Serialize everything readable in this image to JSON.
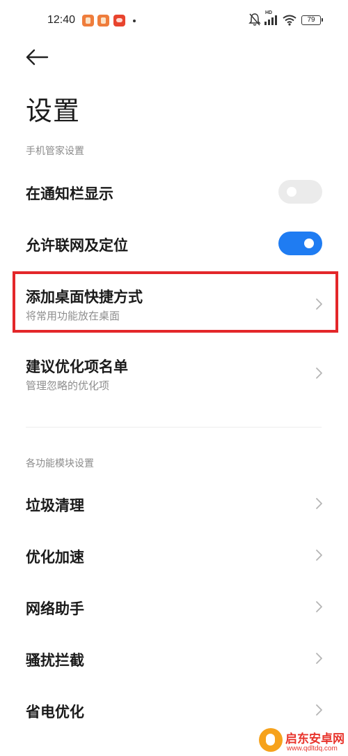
{
  "status_bar": {
    "time": "12:40",
    "battery": "79",
    "network_label": "HD",
    "icons": [
      "app-notification-icon",
      "app-notification-icon",
      "app-notification-icon",
      "mute-icon",
      "signal-icon",
      "wifi-icon",
      "battery-icon"
    ]
  },
  "header": {
    "back_icon": "back-arrow-icon",
    "title": "设置"
  },
  "sections": {
    "phone_manager": {
      "header": "手机管家设置",
      "items": [
        {
          "title": "在通知栏显示",
          "control": "toggle",
          "enabled": false
        },
        {
          "title": "允许联网及定位",
          "control": "toggle",
          "enabled": true
        },
        {
          "title": "添加桌面快捷方式",
          "subtitle": "将常用功能放在桌面",
          "control": "chevron"
        },
        {
          "title": "建议优化项名单",
          "subtitle": "管理忽略的优化项",
          "control": "chevron"
        }
      ]
    },
    "modules": {
      "header": "各功能模块设置",
      "items": [
        {
          "title": "垃圾清理",
          "control": "chevron"
        },
        {
          "title": "优化加速",
          "control": "chevron"
        },
        {
          "title": "网络助手",
          "control": "chevron"
        },
        {
          "title": "骚扰拦截",
          "control": "chevron"
        },
        {
          "title": "省电优化",
          "control": "chevron"
        }
      ]
    }
  },
  "watermark": {
    "title": "启东安卓网",
    "url": "www.qdltdq.com"
  },
  "colors": {
    "accent": "#1f7cf2",
    "highlight": "#e3272a",
    "toggle_off": "#ebebeb"
  }
}
